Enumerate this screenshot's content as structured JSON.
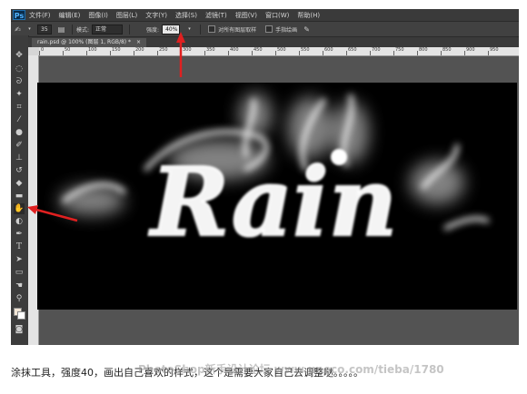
{
  "menubar": {
    "logo": "Ps",
    "items": [
      "文件(F)",
      "编辑(E)",
      "图像(I)",
      "图层(L)",
      "文字(Y)",
      "选择(S)",
      "滤镜(T)",
      "视图(V)",
      "窗口(W)",
      "帮助(H)"
    ]
  },
  "options": {
    "brush_size": "35",
    "mode_label": "模式:",
    "mode_value": "正常",
    "strength_label": "强度:",
    "strength_value": "40%",
    "sample_all_label": "对所有图层取样",
    "finger_paint_label": "手指绘画"
  },
  "document": {
    "tab_label": "rain.psd @ 100% (图层 1, RGB/8) *"
  },
  "ruler": {
    "ticks": [
      "0",
      "50",
      "100",
      "150",
      "200",
      "250",
      "300",
      "350",
      "400",
      "450",
      "500",
      "550",
      "600",
      "650",
      "700",
      "750",
      "800",
      "850",
      "900",
      "950"
    ]
  },
  "canvas": {
    "artwork_text": "Rain"
  },
  "caption": {
    "text": "涂抹工具，强度40，画出自己喜欢的样式，这个是需要大家自己去调整哒。。。。。"
  },
  "watermark": {
    "text": "PhotoShop新手设计论坛 www.uneco.com/tieba/1780"
  },
  "colors": {
    "annotation_arrow": "#e02020",
    "canvas_bg": "#000000",
    "ui_dark": "#3c3c3c"
  }
}
